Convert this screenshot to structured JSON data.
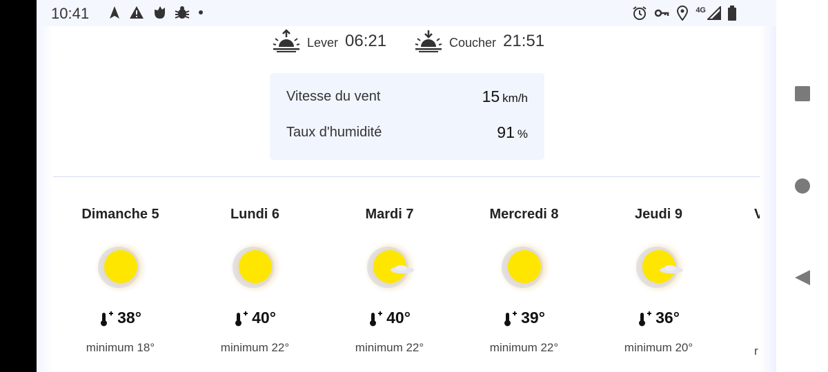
{
  "status_bar": {
    "time": "10:41",
    "left_icons": [
      "navigation-arrow-icon",
      "warning-icon",
      "app-notification-icon",
      "bug-icon",
      "dot-icon"
    ],
    "right_icons": [
      "alarm-icon",
      "vpn-key-icon",
      "location-icon",
      "signal-icon",
      "battery-icon"
    ],
    "network_label": "4G"
  },
  "sun": {
    "sunrise_label": "Lever",
    "sunrise_time": "06:21",
    "sunset_label": "Coucher",
    "sunset_time": "21:51"
  },
  "stats": {
    "wind_label": "Vitesse du vent",
    "wind_value": "15",
    "wind_unit": "km/h",
    "humidity_label": "Taux d'humidité",
    "humidity_value": "91",
    "humidity_unit": "%"
  },
  "forecast": [
    {
      "day": "Dimanche 5",
      "icon": "sun-icon",
      "max": "38°",
      "min": "minimum 18°"
    },
    {
      "day": "Lundi 6",
      "icon": "sun-icon",
      "max": "40°",
      "min": "minimum 22°"
    },
    {
      "day": "Mardi 7",
      "icon": "sun-cloud-icon",
      "max": "40°",
      "min": "minimum 22°"
    },
    {
      "day": "Mercredi 8",
      "icon": "sun-icon",
      "max": "39°",
      "min": "minimum 22°"
    },
    {
      "day": "Jeudi 9",
      "icon": "sun-cloud-icon",
      "max": "36°",
      "min": "minimum 20°"
    },
    {
      "day": "V",
      "min": "r"
    }
  ],
  "colors": {
    "accent_sun": "#ffe600",
    "stats_background": "#f1f5fd",
    "divider": "#d6daf0"
  },
  "nav": {
    "icons": [
      "recents-square-icon",
      "home-circle-icon",
      "back-triangle-icon"
    ]
  }
}
